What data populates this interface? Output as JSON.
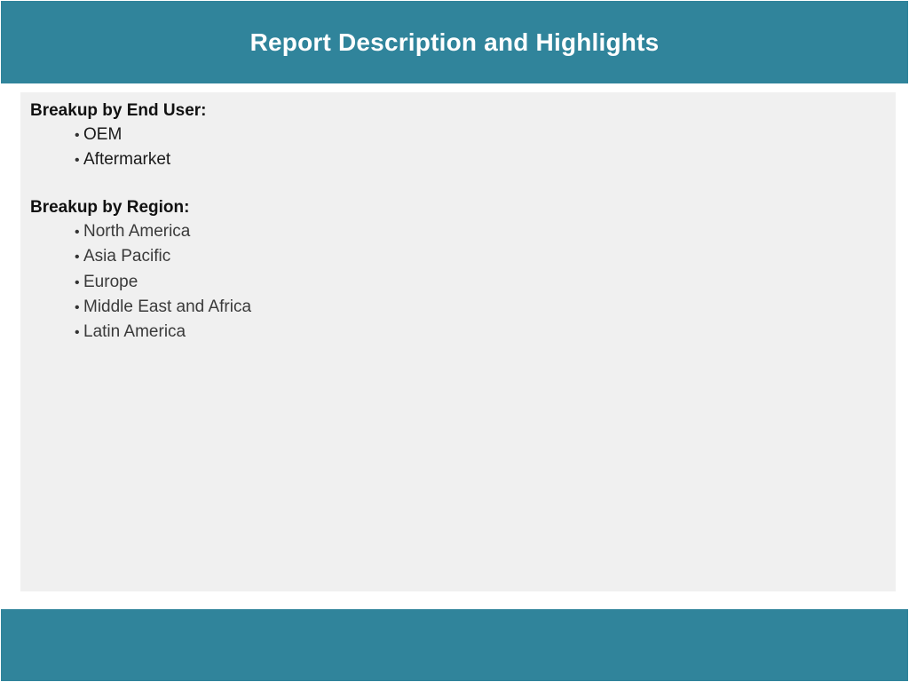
{
  "header": {
    "title": "Report Description and Highlights"
  },
  "sections": {
    "end_user": {
      "heading": "Breakup by End User:",
      "items": [
        "OEM",
        "Aftermarket"
      ]
    },
    "region": {
      "heading": "Breakup by Region:",
      "items": [
        "North America",
        "Asia Pacific",
        "Europe",
        "Middle East and Africa",
        "Latin America"
      ]
    }
  },
  "bullet_glyph": "•",
  "colors": {
    "band": "#30849b",
    "panel": "#f0f0f0",
    "title_text": "#ffffff"
  }
}
